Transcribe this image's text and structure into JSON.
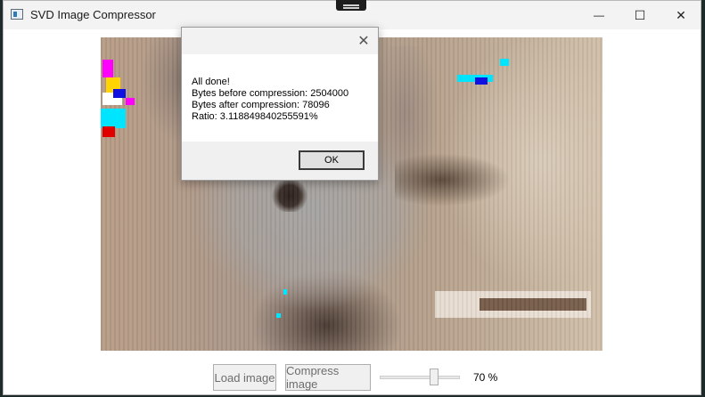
{
  "window": {
    "title": "SVD Image Compressor",
    "minimize_glyph": "—",
    "maximize_glyph": "☐",
    "close_glyph": "✕"
  },
  "image": {
    "description_icon": "photo"
  },
  "dialog": {
    "close_glyph": "✕",
    "lines": [
      "All done!",
      "Bytes before compression: 2504000",
      "Bytes after compression: 78096",
      "Ratio: 3.118849840255591%"
    ],
    "ok_label": "OK"
  },
  "controls": {
    "load_label": "Load image",
    "compress_label": "Compress image",
    "slider_value_fraction": 0.7,
    "slider_value_text": "70 %"
  },
  "colors": {
    "window_bg": "#ffffff",
    "titlebar_bg": "#f3f3f3",
    "button_bg": "#f0f0f0",
    "button_text_disabled": "#6d6d6d"
  }
}
